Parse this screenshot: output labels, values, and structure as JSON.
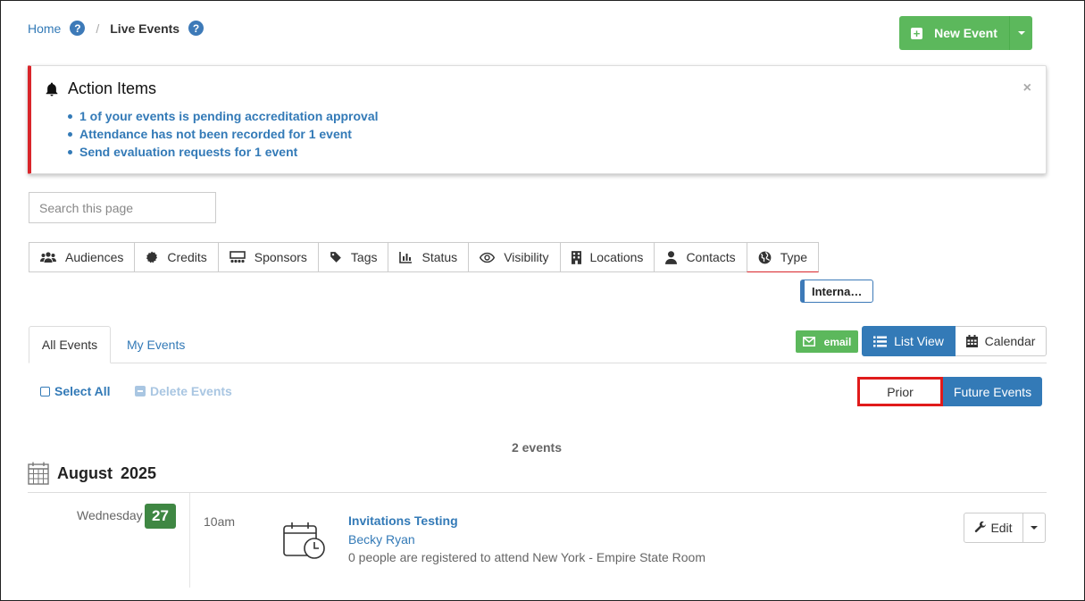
{
  "breadcrumb": {
    "home": "Home",
    "current": "Live Events",
    "help_glyph": "?"
  },
  "header": {
    "new_event_label": "New Event"
  },
  "action_items": {
    "title": "Action Items",
    "close_glyph": "×",
    "items": [
      "1 of your events is pending accreditation approval",
      "Attendance has not been recorded for 1 event",
      "Send evaluation requests for 1 event"
    ]
  },
  "search": {
    "placeholder": "Search this page",
    "value": ""
  },
  "filters": [
    {
      "label": "Audiences",
      "icon": "users-icon"
    },
    {
      "label": "Credits",
      "icon": "badge-icon"
    },
    {
      "label": "Sponsors",
      "icon": "sponsors-icon"
    },
    {
      "label": "Tags",
      "icon": "tag-icon"
    },
    {
      "label": "Status",
      "icon": "bar-chart-icon"
    },
    {
      "label": "Visibility",
      "icon": "eye-icon"
    },
    {
      "label": "Locations",
      "icon": "building-icon"
    },
    {
      "label": "Contacts",
      "icon": "user-icon"
    },
    {
      "label": "Type",
      "icon": "globe-icon"
    }
  ],
  "type_chip": "Interna…",
  "tabs": [
    {
      "label": "All Events",
      "active": true
    },
    {
      "label": "My Events",
      "active": false
    }
  ],
  "toolbar": {
    "email_label": "email",
    "list_view_label": "List View",
    "calendar_label": "Calendar",
    "select_all_label": "Select All",
    "delete_events_label": "Delete Events",
    "prior_label": "Prior",
    "future_label": "Future Events"
  },
  "event_count": "2 events",
  "month": {
    "name": "August",
    "year": "2025"
  },
  "events": [
    {
      "weekday": "Wednesday",
      "day": "27",
      "time": "10am",
      "title": "Invitations Testing",
      "host": "Becky Ryan",
      "description": "0 people are registered to attend New York - Empire State Room",
      "edit_label": "Edit"
    }
  ],
  "colors": {
    "primary": "#337ab7",
    "success": "#5cb85c",
    "danger": "#d9252a",
    "day_badge": "#3f8743"
  }
}
